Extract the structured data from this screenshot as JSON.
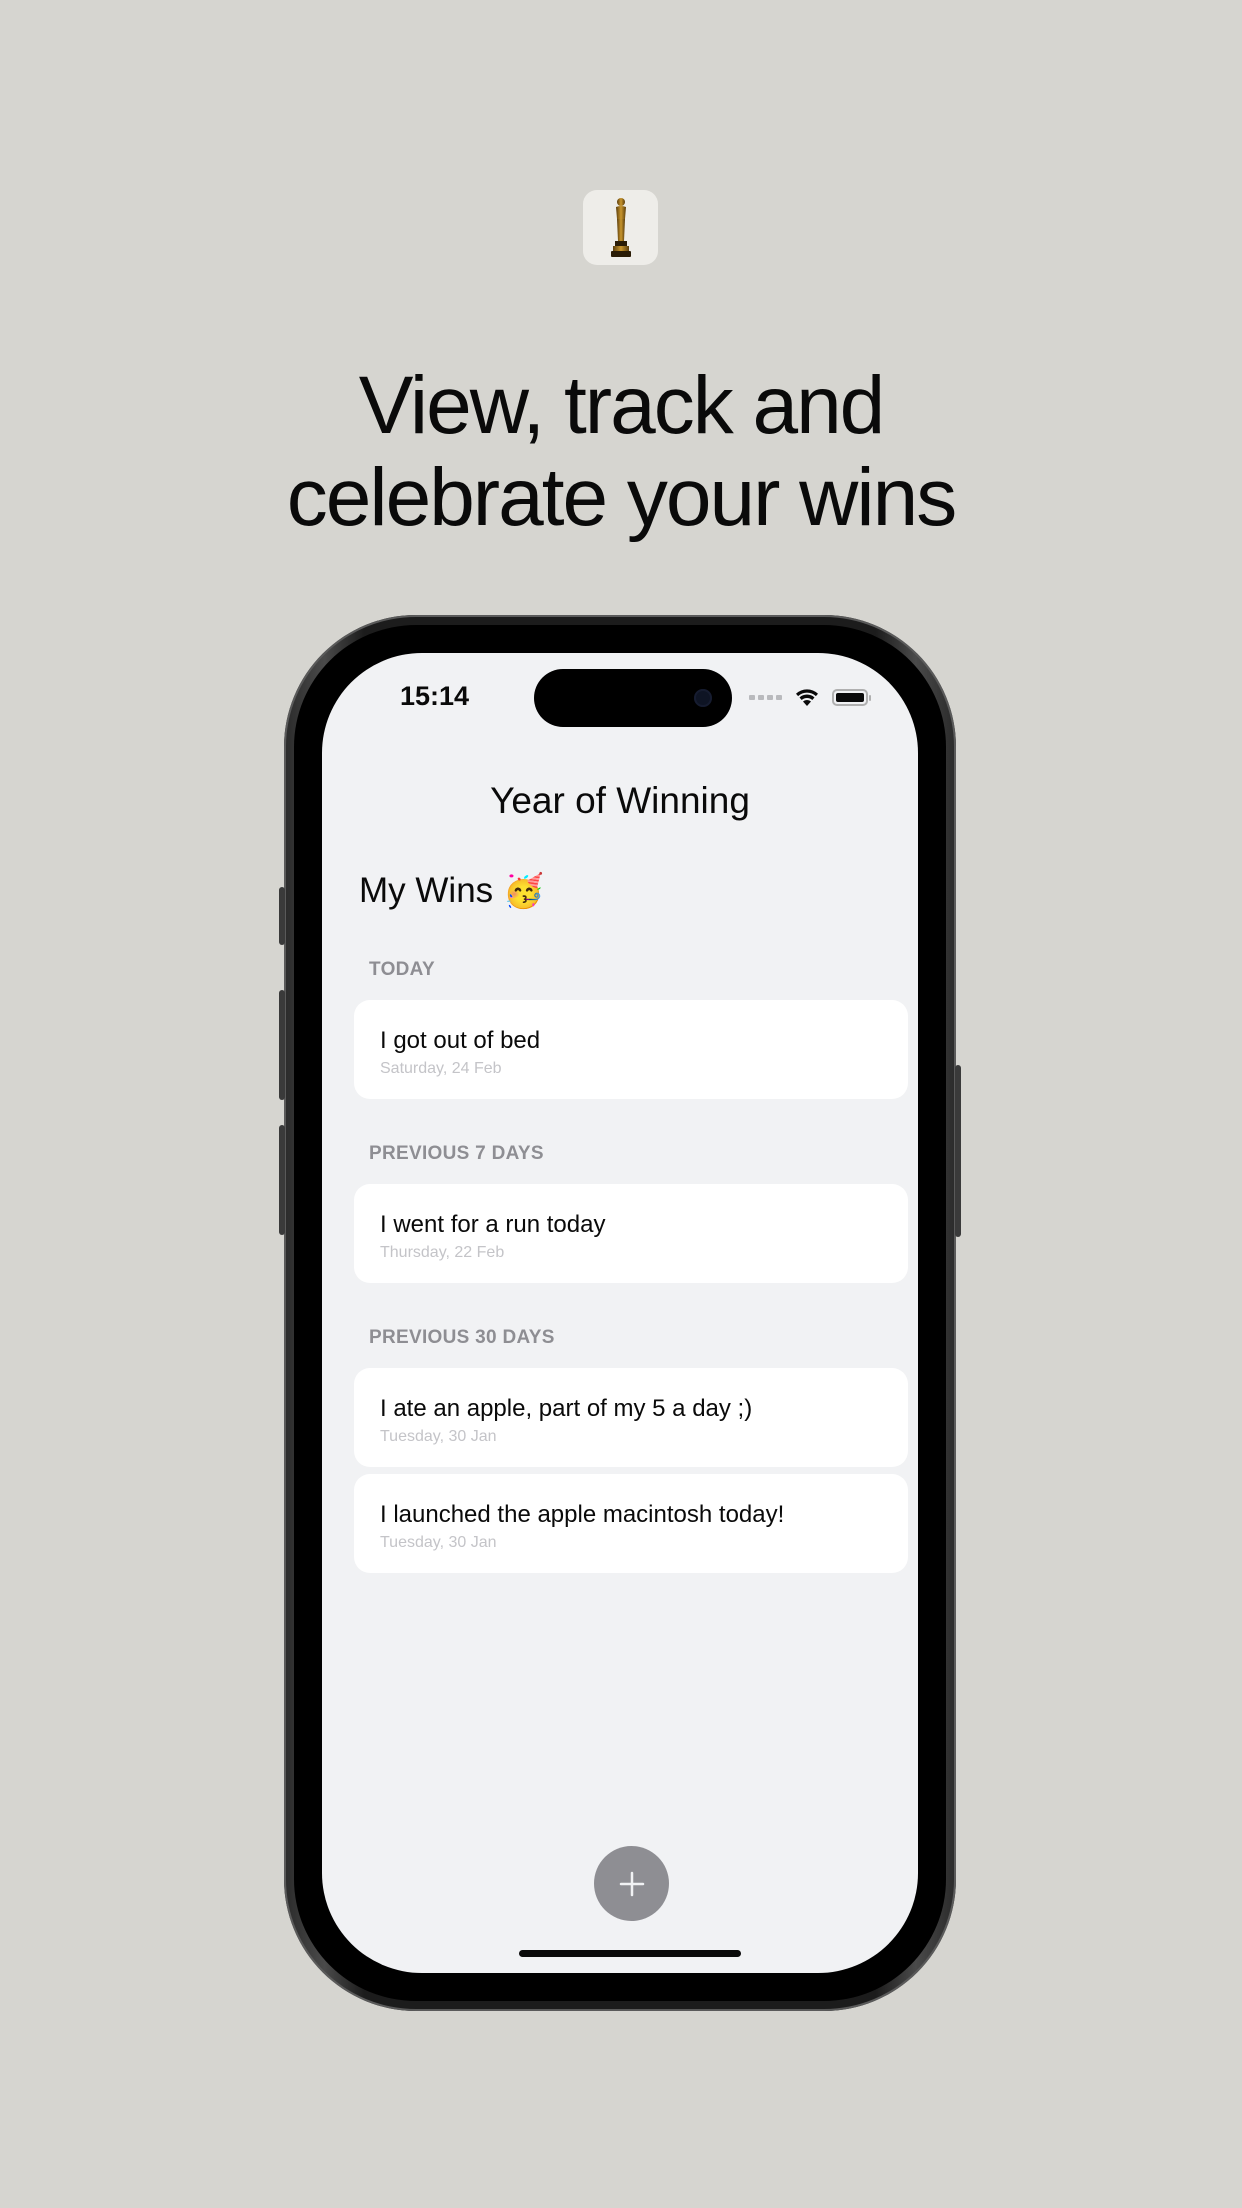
{
  "promo": {
    "headline_line1": "View, track and",
    "headline_line2": "celebrate your wins",
    "badge_icon": "trophy-statue-icon"
  },
  "status_bar": {
    "time": "15:14"
  },
  "app": {
    "nav_title": "Year of Winning",
    "list_title": "My Wins",
    "title_emoji": "🥳"
  },
  "sections": [
    {
      "label": "TODAY",
      "items": [
        {
          "title": "I got out of bed",
          "date": "Saturday, 24 Feb"
        }
      ]
    },
    {
      "label": "PREVIOUS 7 DAYS",
      "items": [
        {
          "title": "I went for a run today",
          "date": "Thursday, 22 Feb"
        }
      ]
    },
    {
      "label": "PREVIOUS 30 DAYS",
      "items": [
        {
          "title": "I ate an apple, part of my 5 a day ;)",
          "date": "Tuesday, 30 Jan"
        },
        {
          "title": "I launched the apple macintosh today!",
          "date": "Tuesday, 30 Jan"
        }
      ]
    }
  ],
  "colors": {
    "background": "#d6d5d0",
    "screen": "#f1f2f4",
    "section_label": "#8e8e93",
    "fab": "#8e8e93"
  }
}
